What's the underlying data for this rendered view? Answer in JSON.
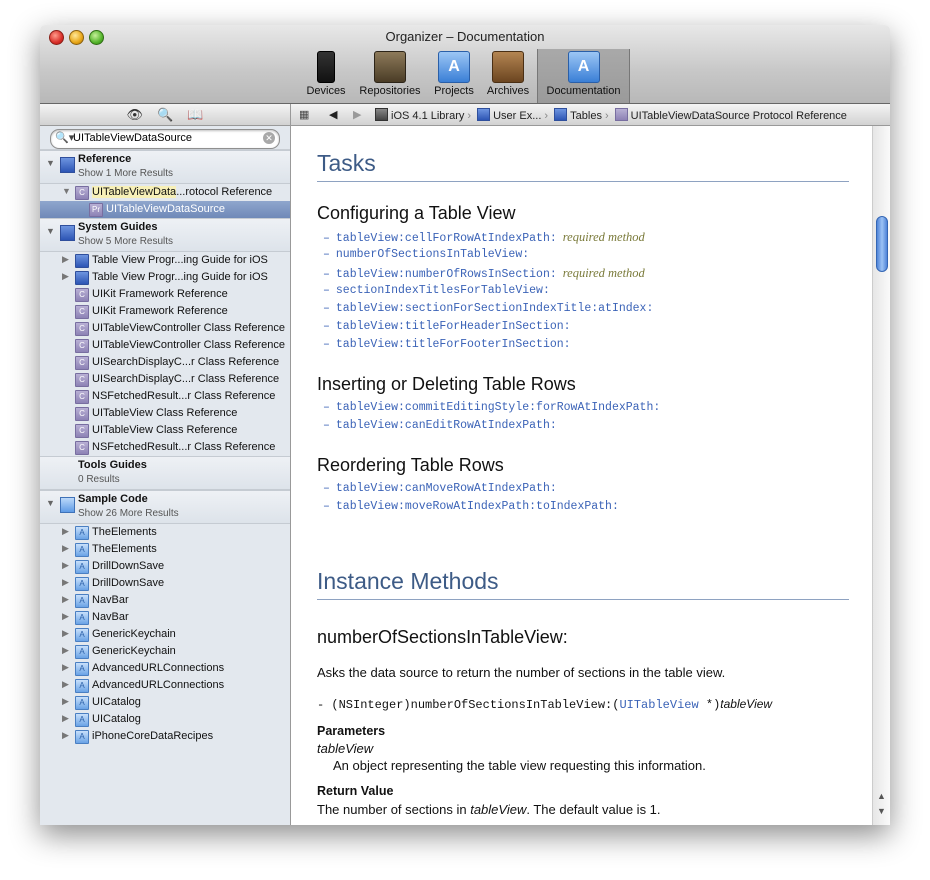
{
  "window": {
    "title": "Organizer – Documentation"
  },
  "toolbar": {
    "items": [
      {
        "label": "Devices",
        "icon": "iphone-icon"
      },
      {
        "label": "Repositories",
        "icon": "repositories-icon"
      },
      {
        "label": "Projects",
        "icon": "projects-icon"
      },
      {
        "label": "Archives",
        "icon": "archives-icon"
      },
      {
        "label": "Documentation",
        "icon": "documentation-icon",
        "selected": true
      }
    ]
  },
  "sidebar": {
    "search": {
      "value": "UITableViewDataSource"
    },
    "groups": {
      "reference": {
        "name": "Reference",
        "sub": "Show 1 More Results"
      },
      "system": {
        "name": "System Guides",
        "sub": "Show 5 More Results"
      },
      "tools": {
        "name": "Tools Guides",
        "sub": "0 Results"
      },
      "sample": {
        "name": "Sample Code",
        "sub": "Show 26 More Results"
      }
    },
    "reference_items": {
      "protocol_ref": {
        "a": "UITableViewData",
        "b": "...rotocol Reference"
      },
      "selected": "UITableViewDataSource"
    },
    "system_items": [
      "Table View Progr...ing Guide for iOS",
      "Table View Progr...ing Guide for iOS",
      "UIKit Framework Reference",
      "UIKit Framework Reference",
      "UITableViewController Class Reference",
      "UITableViewController Class Reference",
      "UISearchDisplayC...r Class Reference",
      "UISearchDisplayC...r Class Reference",
      "NSFetchedResult...r Class Reference",
      "UITableView Class Reference",
      "UITableView Class Reference",
      "NSFetchedResult...r Class Reference"
    ],
    "sample_items": [
      "TheElements",
      "TheElements",
      "DrillDownSave",
      "DrillDownSave",
      "NavBar",
      "NavBar",
      "GenericKeychain",
      "GenericKeychain",
      "AdvancedURLConnections",
      "AdvancedURLConnections",
      "UICatalog",
      "UICatalog",
      "iPhoneCoreDataRecipes"
    ]
  },
  "jumpbar": {
    "crumbs": [
      "iOS 4.1 Library",
      "User Ex...",
      "Tables",
      "UITableViewDataSource Protocol Reference"
    ]
  },
  "doc": {
    "tasks_heading": "Tasks",
    "sections": {
      "configuring": "Configuring a Table View",
      "inserting": "Inserting or Deleting Table Rows",
      "reordering": "Reordering Table Rows"
    },
    "configuring_tasks": [
      {
        "name": "tableView:cellForRowAtIndexPath:",
        "note": "required method"
      },
      {
        "name": "numberOfSectionsInTableView:",
        "note": ""
      },
      {
        "name": "tableView:numberOfRowsInSection:",
        "note": "required method"
      },
      {
        "name": "sectionIndexTitlesForTableView:",
        "note": ""
      },
      {
        "name": "tableView:sectionForSectionIndexTitle:atIndex:",
        "note": ""
      },
      {
        "name": "tableView:titleForHeaderInSection:",
        "note": ""
      },
      {
        "name": "tableView:titleForFooterInSection:",
        "note": ""
      }
    ],
    "inserting_tasks": [
      "tableView:commitEditingStyle:forRowAtIndexPath:",
      "tableView:canEditRowAtIndexPath:"
    ],
    "reordering_tasks": [
      "tableView:canMoveRowAtIndexPath:",
      "tableView:moveRowAtIndexPath:toIndexPath:"
    ],
    "instance_heading": "Instance Methods",
    "method_name": "numberOfSectionsInTableView:",
    "method_desc": "Asks the data source to return the number of sections in the table view.",
    "decl_prefix": "- (NSInteger)numberOfSectionsInTableView:(",
    "decl_type": "UITableView",
    "decl_star": " *)",
    "decl_arg": "tableView",
    "params_label": "Parameters",
    "param_name": "tableView",
    "param_desc": "An object representing the table view requesting this information.",
    "return_label": "Return Value",
    "return_a": "The number of sections in ",
    "return_arg": "tableView",
    "return_b": ". The default value is 1."
  },
  "colors": {
    "link": "#3b63b7",
    "heading": "#3d5b86",
    "selection": "#6f89b8"
  }
}
